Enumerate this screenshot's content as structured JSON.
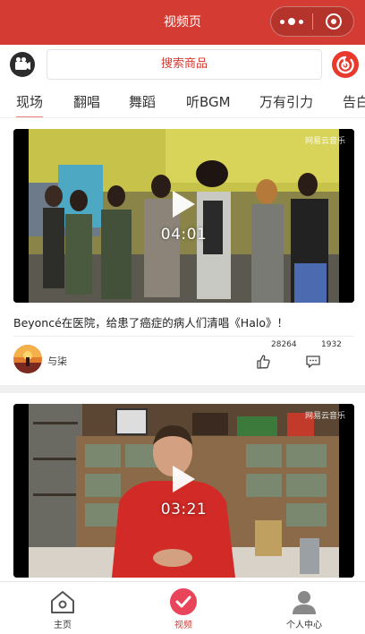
{
  "header": {
    "title": "视频页"
  },
  "search": {
    "placeholder": "搜索商品"
  },
  "tabs": [
    {
      "label": "现场",
      "active": true
    },
    {
      "label": "翻唱"
    },
    {
      "label": "舞蹈"
    },
    {
      "label": "听BGM"
    },
    {
      "label": "万有引力"
    },
    {
      "label": "告白"
    }
  ],
  "videos": [
    {
      "duration": "04:01",
      "watermark": "网易云音乐",
      "title": "Beyoncé在医院，给患了癌症的病人们清唱《Halo》！",
      "author": "与柒",
      "likes": "28264",
      "comments": "1932"
    },
    {
      "duration": "03:21",
      "watermark": "网易云音乐"
    }
  ],
  "bottom_nav": [
    {
      "label": "主页",
      "icon": "home-icon"
    },
    {
      "label": "视频",
      "icon": "video-icon",
      "active": true
    },
    {
      "label": "个人中心",
      "icon": "person-icon"
    }
  ],
  "colors": {
    "brand": "#d43c33",
    "tab_indicator": "#e97f7a"
  }
}
